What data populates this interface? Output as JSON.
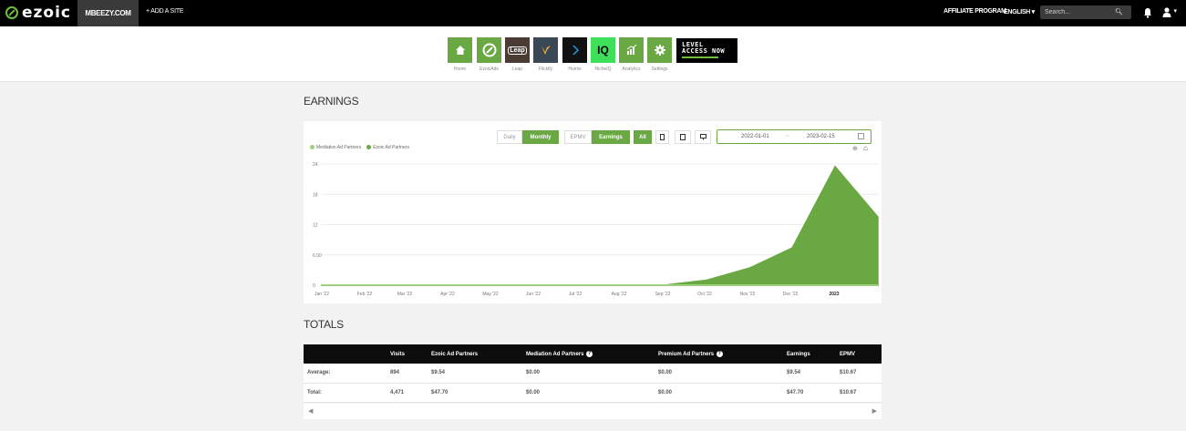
{
  "topbar": {
    "logo_text": "ezoic",
    "site_tab": "MBEEZY.COM",
    "add_site": "+ ADD A SITE",
    "affiliate": "AFFILIATE PROGRAM",
    "language": "ENGLISH",
    "search_placeholder": "Search..."
  },
  "apps": [
    {
      "label": "Home",
      "icon": "home-icon",
      "color": "#6aa843"
    },
    {
      "label": "EzoicAds",
      "icon": "ezoic-ads-icon",
      "color": "#6aa843"
    },
    {
      "label": "Leap",
      "icon": "leap-icon",
      "color": "#4a3b34",
      "text": "Leap"
    },
    {
      "label": "Flickify",
      "icon": "flickify-icon",
      "color": "#3a4754"
    },
    {
      "label": "Humix",
      "icon": "humix-icon",
      "color": "#111111"
    },
    {
      "label": "NicheIQ",
      "icon": "nicheiq-icon",
      "color": "#3ee05a",
      "text": "IQ"
    },
    {
      "label": "Analytics",
      "icon": "analytics-icon",
      "color": "#6aa843"
    },
    {
      "label": "Settings",
      "icon": "settings-icon",
      "color": "#6aa843"
    }
  ],
  "level_banner": {
    "line1": "LEVEL",
    "line2": "ACCESS NOW"
  },
  "earnings": {
    "title": "EARNINGS",
    "buttons": {
      "daily": "Daily",
      "monthly": "Monthly",
      "epmv": "EPMV",
      "earnings": "Earnings",
      "all": "All"
    },
    "date_start": "2022-01-01",
    "date_sep": "~",
    "date_end": "2023-02-15"
  },
  "chart_data": {
    "type": "area",
    "categories": [
      "Jan '22",
      "Feb '22",
      "Mar '22",
      "Apr '22",
      "May '22",
      "Jun '22",
      "Jul '22",
      "Aug '22",
      "Sep '22",
      "Oct '22",
      "Nov '22",
      "Dec '22",
      "2023",
      ""
    ],
    "series": [
      {
        "name": "Mediation Ad Partners",
        "color": "#9fd07f",
        "values": [
          0,
          0,
          0,
          0,
          0,
          0,
          0,
          0,
          0,
          0,
          0,
          0,
          0,
          0
        ]
      },
      {
        "name": "Ezoic Ad Partners",
        "color": "#6aa843",
        "values": [
          0,
          0,
          0,
          0,
          0,
          0,
          0,
          0,
          0,
          1.0,
          3.4,
          7.4,
          23.5,
          13.5
        ]
      }
    ],
    "yticks": [
      "0",
      "6.00",
      "12",
      "18",
      "24"
    ],
    "ylim": [
      0,
      24
    ],
    "grid": true,
    "legend": "top-left"
  },
  "totals": {
    "title": "TOTALS",
    "headers": [
      "",
      "Visits",
      "Ezoic Ad Partners",
      "Mediation Ad Partners",
      "Premium Ad Partners",
      "Earnings",
      "EPMV"
    ],
    "rows": [
      [
        "Average:",
        "894",
        "$9.54",
        "$0.00",
        "$0.00",
        "$9.54",
        "$10.67"
      ],
      [
        "Total:",
        "4,471",
        "$47.70",
        "$0.00",
        "$0.00",
        "$47.70",
        "$10.67"
      ]
    ]
  }
}
